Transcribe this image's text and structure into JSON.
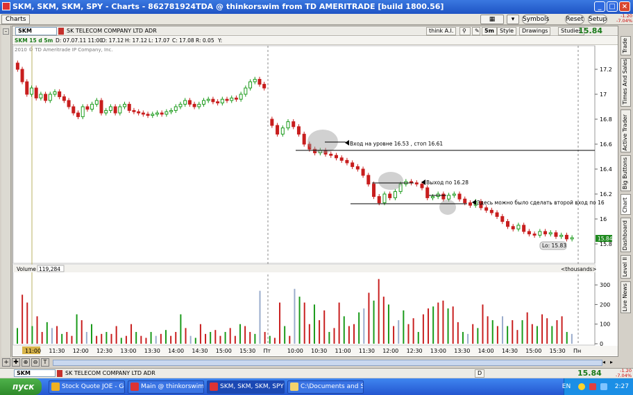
{
  "window": {
    "title": "SKM, SKM, SKM, SPY - Charts - 862781924TDA @ thinkorswim from TD AMERITRADE [build 1800.56]",
    "tab": "Charts",
    "buttons": {
      "symbols": "Symbols",
      "reset": "Reset",
      "setup": "Setup"
    },
    "price_change_top": "-1.20",
    "price_change_pct_top": "-7.04%"
  },
  "chart_header": {
    "symbol": "SKM",
    "company": "SK TELECOM COMPANY LTD ADR",
    "think_ai": "think A.I.",
    "timeframe": "5m",
    "style": "Style",
    "drawings": "Drawings",
    "studies": "Studies",
    "last_price": "15.84"
  },
  "ohlc": {
    "label": "SKM 15 d 5m",
    "date": "D: 07.07.11 11:00",
    "open": "O: 17.12",
    "high": "H: 17.12",
    "low": "L: 17.07",
    "close": "C: 17.08",
    "range": "R: 0.05",
    "y": "Y:"
  },
  "copyright": "2010 © TD Ameritrade IP Company, Inc.",
  "price_axis_ticks": [
    "17.2",
    "17",
    "16.8",
    "16.6",
    "16.4",
    "16.2",
    "16",
    "15.8"
  ],
  "price_tag": "15.84",
  "low_label": "Lo: 15.83",
  "annotations": [
    "Вход на уровне 16.53 , стоп 16.61",
    "Выход по 16.28",
    "Здесь можно было сделать второй вход по 16"
  ],
  "volume": {
    "label": "Volume",
    "value": "119,284",
    "units": "<thousands>",
    "ticks": [
      "300",
      "200",
      "100",
      "0"
    ]
  },
  "time_axis": [
    "11:00",
    "11:30",
    "12:00",
    "12:30",
    "13:00",
    "13:30",
    "14:00",
    "14:30",
    "15:00",
    "15:30",
    "Пт",
    "10:00",
    "10:30",
    "11:00",
    "11:30",
    "12:00",
    "12:30",
    "13:00",
    "13:30",
    "14:00",
    "14:30",
    "15:00",
    "15:30",
    "Пн"
  ],
  "right_tabs": [
    "Trade",
    "Times And Sales",
    "Active Trader",
    "Big Buttons",
    "Chart",
    "Dashboard",
    "Level II",
    "Live News"
  ],
  "bottom_symbol": {
    "symbol": "SKM",
    "company": "SK TELECOM COMPANY LTD ADR",
    "timeframe": "D",
    "last_price": "15.84",
    "change": "-1.20",
    "change_pct": "-7.04%"
  },
  "taskbar": {
    "start": "пуск",
    "items": [
      "Stock Quote JOE - Go...",
      "Main @ thinkorswim f...",
      "SKM, SKM, SKM, SPY ...",
      "C:\\Documents and Se..."
    ],
    "lang": "EN",
    "clock": "2:27"
  },
  "chart_data": {
    "type": "candlestick",
    "price_ylim": [
      15.7,
      17.3
    ],
    "volume_ylim": [
      0,
      350
    ],
    "up_color": "#1a9a1a",
    "down_color": "#c81e1e",
    "day1_close": [
      17.2,
      17.1,
      17.0,
      17.05,
      16.97,
      17.0,
      16.95,
      17.0,
      17.02,
      16.98,
      16.95,
      16.9,
      16.85,
      16.82,
      16.9,
      16.88,
      16.92,
      16.95,
      16.85,
      16.87,
      16.9,
      16.85,
      16.9,
      16.92,
      16.87,
      16.86,
      16.85,
      16.84,
      16.83,
      16.84,
      16.85,
      16.84,
      16.86,
      16.87,
      16.9,
      16.92,
      16.95,
      16.92,
      16.9,
      16.92,
      16.95,
      16.96,
      16.94,
      16.93,
      16.96,
      16.95,
      16.97,
      16.96,
      17.0,
      17.05,
      17.1,
      17.12,
      17.08,
      17.05
    ],
    "day2_close": [
      16.75,
      16.68,
      16.73,
      16.78,
      16.74,
      16.68,
      16.6,
      16.56,
      16.53,
      16.55,
      16.52,
      16.51,
      16.49,
      16.47,
      16.45,
      16.42,
      16.4,
      16.35,
      16.28,
      16.18,
      16.13,
      16.2,
      16.17,
      16.22,
      16.28,
      16.3,
      16.29,
      16.28,
      16.25,
      16.17,
      16.18,
      16.2,
      16.16,
      16.19,
      16.2,
      16.16,
      16.13,
      16.11,
      16.14,
      16.09,
      16.07,
      16.05,
      16.02,
      15.98,
      15.94,
      15.92,
      15.95,
      15.9,
      15.88,
      15.87,
      15.9,
      15.88,
      15.89,
      15.86,
      15.87,
      15.84,
      15.85
    ],
    "volume": [
      80,
      250,
      210,
      90,
      140,
      60,
      110,
      80,
      90,
      50,
      60,
      40,
      150,
      120,
      60,
      100,
      40,
      50,
      60,
      50,
      90,
      30,
      40,
      100,
      60,
      40,
      30,
      60,
      40,
      50,
      70,
      40,
      60,
      150,
      80,
      40,
      30,
      100,
      50,
      60,
      70,
      40,
      60,
      80,
      40,
      100,
      90,
      60,
      50,
      270,
      60,
      40,
      30,
      210,
      90,
      40,
      280,
      240,
      210,
      100,
      200,
      120,
      170,
      60,
      80,
      210,
      140,
      90,
      100,
      160,
      180,
      260,
      220,
      330,
      240,
      200,
      90,
      120,
      170,
      100,
      130,
      60,
      150,
      180,
      190,
      210,
      220,
      180,
      190,
      110,
      60,
      50,
      100,
      80,
      200,
      140,
      120,
      90,
      140,
      90,
      120,
      70,
      120,
      160,
      100,
      90,
      150,
      130,
      90,
      120,
      140,
      60,
      50
    ]
  }
}
